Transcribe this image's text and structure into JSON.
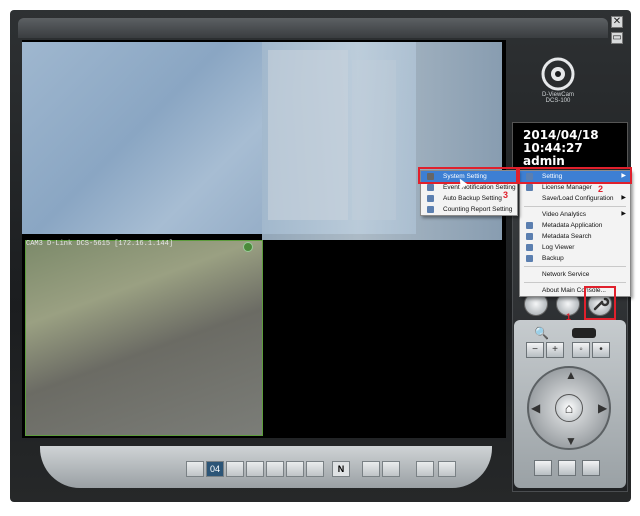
{
  "window": {
    "minimize_glyph": "▭",
    "close_glyph": "✕",
    "brand": "D-ViewCam",
    "brand_sub": "DCS-100"
  },
  "clock": {
    "date": "2014/04/18",
    "time": "10:44:27",
    "user": "admin"
  },
  "camera": {
    "label": "CAM3 D-Link DCS-5615 [172.16.1.144]"
  },
  "layout_bar": {
    "active_label": "04",
    "n_label": "N"
  },
  "main_menu": {
    "items": [
      {
        "label": "Setting",
        "highlighted": true,
        "submenu": true
      },
      {
        "label": "License Manager"
      },
      {
        "label": "Save/Load Configuration",
        "submenu": true
      },
      {
        "label": "Video Analytics",
        "submenu": true
      },
      {
        "label": "Metadata Application"
      },
      {
        "label": "Metadata Search"
      },
      {
        "label": "Log Viewer"
      },
      {
        "label": "Backup"
      },
      {
        "label": "Network Service"
      },
      {
        "label": "About Main Console..."
      }
    ]
  },
  "sub_menu": {
    "items": [
      {
        "label": "System Setting",
        "highlighted": true
      },
      {
        "label": "Event Notification Setting"
      },
      {
        "label": "Auto Backup Setting"
      },
      {
        "label": "Counting Report Setting"
      }
    ]
  },
  "callouts": {
    "step1": "1",
    "step2": "2",
    "step3": "3"
  },
  "colors": {
    "highlight": "#3d7fd3",
    "callout": "#e0202c",
    "panel": "#1b1d1f"
  }
}
